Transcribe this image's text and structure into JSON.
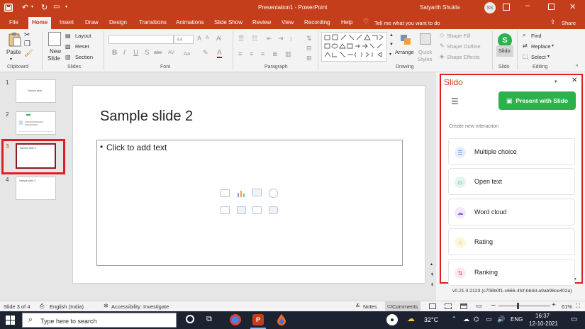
{
  "window": {
    "doc_title": "Presentation1  -  PowerPoint",
    "user_name": "Satyarth Shukla",
    "user_initials": "SS",
    "accent_color": "#c43e1c"
  },
  "tabs": [
    "File",
    "Home",
    "Insert",
    "Draw",
    "Design",
    "Transitions",
    "Animations",
    "Slide Show",
    "Review",
    "View",
    "Recording",
    "Help"
  ],
  "tell_me": "Tell me what you want to do",
  "share_label": "Share",
  "ribbon": {
    "clipboard": {
      "paste": "Paste",
      "group": "Clipboard"
    },
    "slides": {
      "new_slide_1": "New",
      "new_slide_2": "Slide",
      "layout": "Layout",
      "reset": "Reset",
      "section": "Section",
      "group": "Slides"
    },
    "font": {
      "size": "44",
      "group": "Font",
      "bold": "B",
      "italic": "I",
      "underline": "U",
      "strike": "S",
      "shadow": "abc",
      "spacing": "AV",
      "case": "Aa",
      "color": "A"
    },
    "paragraph": {
      "group": "Paragraph"
    },
    "drawing": {
      "arrange": "Arrange",
      "quick_1": "Quick",
      "quick_2": "Styles",
      "shape_fill": "Shape Fill",
      "shape_outline": "Shape Outline",
      "shape_effects": "Shape Effects",
      "group": "Drawing"
    },
    "slido": {
      "label": "Slido",
      "group": "Slido"
    },
    "editing": {
      "find": "Find",
      "replace": "Replace",
      "select": "Select",
      "group": "Editing"
    }
  },
  "thumbnails": [
    {
      "num": "1",
      "text": "Sample slide"
    },
    {
      "num": "2",
      "text": ""
    },
    {
      "num": "3",
      "text": "Sample slide 2"
    },
    {
      "num": "4",
      "text": "Sample slide 3"
    }
  ],
  "slide": {
    "title": "Sample slide 2",
    "bullet": "•",
    "placeholder": "Click to add text"
  },
  "slido_pane": {
    "title": "Slido",
    "present_button": "Present with Slido",
    "section_label": "Create new interaction",
    "interactions": [
      {
        "label": "Multiple choice",
        "color": "#e6eefb"
      },
      {
        "label": "Open text",
        "color": "#e3f5f1"
      },
      {
        "label": "Word cloud",
        "color": "#f1e9fb"
      },
      {
        "label": "Rating",
        "color": "#fdf6df"
      },
      {
        "label": "Ranking",
        "color": "#fbe8f0"
      }
    ],
    "version": "v0.21.0.2123 (c708b0f1-c666-4fcf-bb4d-a9ab98ce402a)",
    "brand_color": "#2bb24c"
  },
  "statusbar": {
    "slide_info": "Slide 3 of 4",
    "language": "English (India)",
    "accessibility": "Accessibility: Investigate",
    "notes": "Notes",
    "comments": "Comments",
    "zoom": "61%"
  },
  "taskbar": {
    "search_placeholder": "Type here to search",
    "temperature": "32°C",
    "language": "ENG",
    "time": "16:37",
    "date": "12-10-2021"
  }
}
